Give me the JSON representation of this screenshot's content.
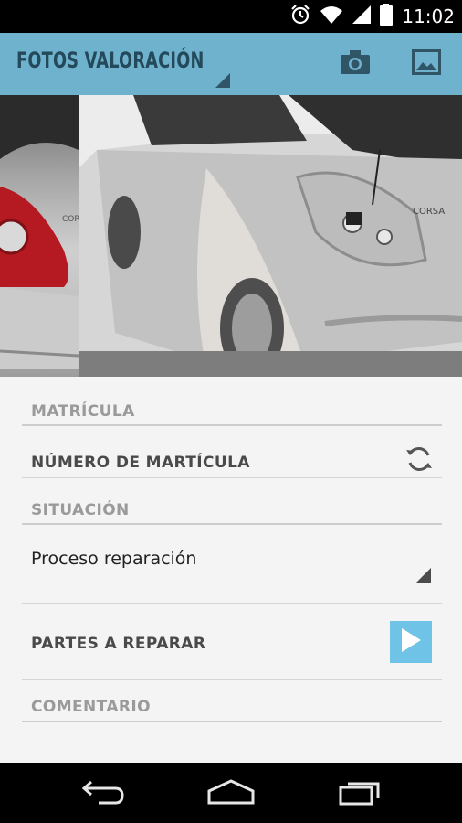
{
  "status_bar": {
    "time": "11:02",
    "icons": [
      "alarm-icon",
      "wifi-icon",
      "signal-icon",
      "battery-icon"
    ]
  },
  "action_bar": {
    "title": "FOTOS VALORACIÓN",
    "icons": [
      "camera-icon",
      "gallery-icon"
    ],
    "background": "#6fb2cd",
    "title_color": "#24495a"
  },
  "photos": {
    "items": [
      {
        "vehicle_text": "CORSA"
      },
      {
        "vehicle_text": "CORSA"
      }
    ]
  },
  "form": {
    "matricula_label": "MATRÍCULA",
    "matricula_value": "NÚMERO DE MARTÍCULA",
    "situacion_label": "SITUACIÓN",
    "situacion_value": "Proceso reparación",
    "partes_label": "PARTES A REPARAR",
    "comentario_label": "COMENTARIO",
    "accent": "#6fc3e6"
  },
  "nav_bar": {
    "buttons": [
      "back-icon",
      "home-icon",
      "recent-apps-icon"
    ]
  }
}
